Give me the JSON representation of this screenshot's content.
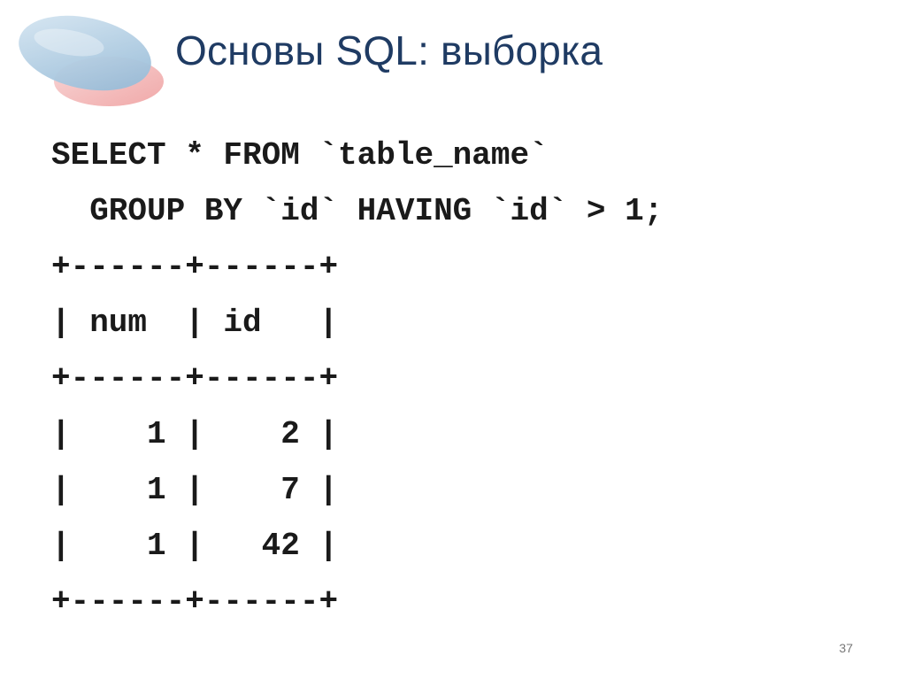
{
  "slide": {
    "title": "Основы SQL: выборка",
    "page_number": "37"
  },
  "code_lines": [
    "SELECT * FROM `table_name`",
    "  GROUP BY `id` HAVING `id` > 1;",
    "+------+------+",
    "| num  | id   |",
    "+------+------+",
    "|    1 |    2 |",
    "|    1 |    7 |",
    "|    1 |   42 |",
    "+------+------+"
  ],
  "colors": {
    "title": "#1f3b63",
    "logo_blue": "#a9c9e0",
    "logo_red": "#f2b7b7",
    "code_text": "#1a1a1a"
  }
}
